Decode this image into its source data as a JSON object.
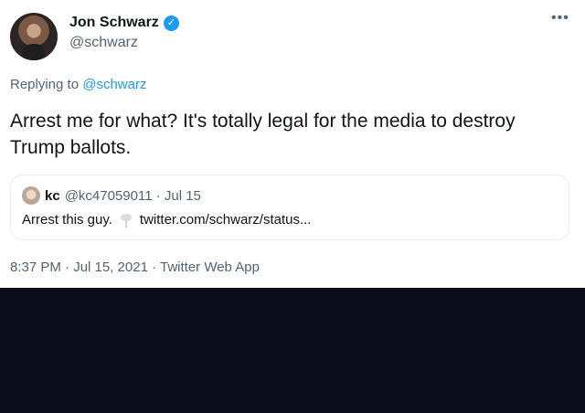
{
  "author": {
    "display_name": "Jon Schwarz",
    "handle": "@schwarz"
  },
  "icons": {
    "verified": "verified-badge-icon",
    "more": "more-options-icon",
    "link_emoji": "pushpin-icon"
  },
  "reply_context": {
    "prefix": "Replying to",
    "to": "@schwarz"
  },
  "tweet": {
    "text": "Arrest me for what? It's totally legal for the media to destroy Trump ballots."
  },
  "quoted_tweet": {
    "name": "kc",
    "handle_date": "@kc47059011 · Jul 15",
    "text": "Arrest this guy.",
    "link": "twitter.com/schwarz/status..."
  },
  "meta": {
    "timestamp": "8:37 PM · Jul 15, 2021 · Twitter Web App"
  },
  "colors": {
    "link": "#1d9bf0",
    "muted": "#536471",
    "text": "#0f1419",
    "background_below": "#0b0c1c"
  }
}
